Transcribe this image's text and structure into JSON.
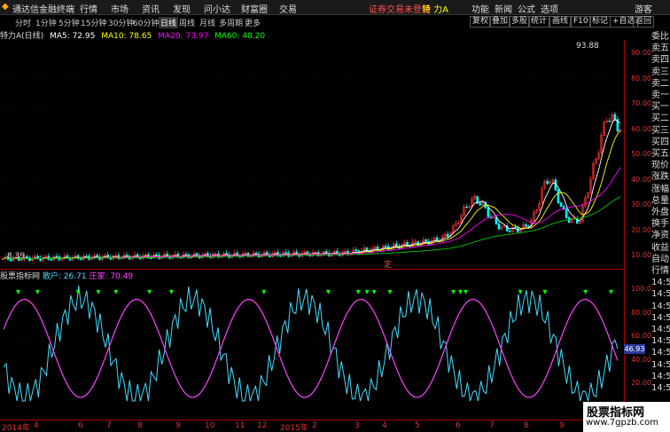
{
  "app": {
    "title": "通达信金融终端",
    "menu": [
      "行情",
      "市场",
      "资讯",
      "发现",
      "问小达",
      "财富圈",
      "交易"
    ],
    "status": "证券交易未登录",
    "stock": "特 力A",
    "right_menu": [
      "功能",
      "新闻",
      "公式",
      "选项"
    ],
    "user": "游客"
  },
  "timeframes": [
    "分时",
    "1分钟",
    "5分钟",
    "15分钟",
    "30分钟",
    "60分钟",
    "日线",
    "周线",
    "月线",
    "多周期",
    "更多"
  ],
  "active_timeframe": "日线",
  "tools": [
    "复权",
    "叠加",
    "多股",
    "统计",
    "画线",
    "F10",
    "标记",
    "+自选",
    "返回"
  ],
  "chart": {
    "title": "特力A(日线)",
    "ma": [
      {
        "label": "MA5: 72.95",
        "color": "#ffffff"
      },
      {
        "label": "MA10: 78.65",
        "color": "#ffff00"
      },
      {
        "label": "MA20: 73.97",
        "color": "#ff00ff"
      },
      {
        "label": "MA60: 48.20",
        "color": "#00ff00"
      }
    ],
    "high_label": "93.88",
    "low_label": "8.39",
    "marker": "定",
    "y_ticks": [
      "90.00",
      "80.00",
      "70.00",
      "60.00",
      "50.00",
      "40.00",
      "30.00",
      "20.00",
      "10.00"
    ]
  },
  "indicator": {
    "name": "股票指标网",
    "series": [
      {
        "label": "散户: 26.71",
        "color": "#44ddff"
      },
      {
        "label": "庄家: 70.49",
        "color": "#ff44ff"
      }
    ],
    "y_ticks": [
      "100.0",
      "80.00",
      "60.00",
      "40.00",
      "20.00"
    ],
    "current": "46.93"
  },
  "x_axis": [
    "2014年",
    "4",
    "6",
    "7",
    "8",
    "9",
    "10",
    "11",
    "12",
    "2015年",
    "2",
    "3",
    "4",
    "5",
    "6",
    "7",
    "8",
    "9",
    "10",
    "11"
  ],
  "right_panel": [
    "委比",
    "卖五",
    "卖四",
    "卖三",
    "卖二",
    "卖一",
    "买一",
    "买二",
    "买三",
    "买四",
    "买五",
    "现价",
    "涨跌",
    "涨幅",
    "总量",
    "外盘",
    "换手",
    "净资",
    "收益",
    "自动",
    "行情",
    "14:5",
    "14:5",
    "14:5",
    "14:5",
    "14:5",
    "14:5",
    "14:5",
    "14:5",
    "14:5",
    "14:5"
  ],
  "watermark": {
    "title": "股票指标网",
    "url": "www.7gpzb.com"
  },
  "colors": {
    "up": "#ff3030",
    "down": "#00ffff",
    "ma60": "#00cc00",
    "axis": "#aa0000"
  }
}
